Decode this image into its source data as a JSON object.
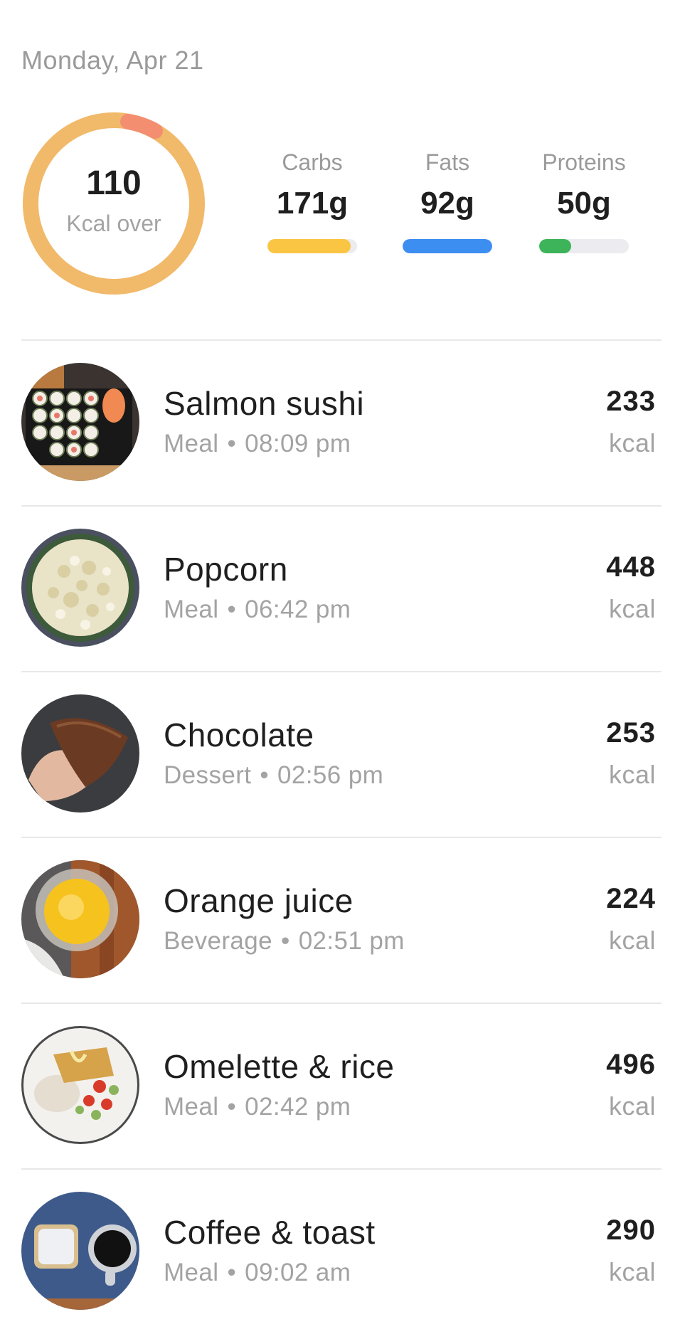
{
  "header": {
    "date": "Monday, Apr 21"
  },
  "summary": {
    "kcal_value": "110",
    "kcal_label": "Kcal over",
    "ring_color": "#f1b96a",
    "ring_accent_color": "#f38a72",
    "macros": [
      {
        "label": "Carbs",
        "value": "171g",
        "color": "#fbc544",
        "fill": 0.93
      },
      {
        "label": "Fats",
        "value": "92g",
        "color": "#3d8ef1",
        "fill": 1.0
      },
      {
        "label": "Proteins",
        "value": "50g",
        "color": "#3db35a",
        "fill": 0.36
      }
    ]
  },
  "entries": [
    {
      "name": "Salmon sushi",
      "category": "Meal",
      "time": "08:09 pm",
      "kcal": "233",
      "unit": "kcal",
      "image": "sushi-photo"
    },
    {
      "name": "Popcorn",
      "category": "Meal",
      "time": "06:42 pm",
      "kcal": "448",
      "unit": "kcal",
      "image": "popcorn-photo"
    },
    {
      "name": "Chocolate",
      "category": "Dessert",
      "time": "02:56 pm",
      "kcal": "253",
      "unit": "kcal",
      "image": "chocolate-photo"
    },
    {
      "name": "Orange juice",
      "category": "Beverage",
      "time": "02:51 pm",
      "kcal": "224",
      "unit": "kcal",
      "image": "orange-juice-photo"
    },
    {
      "name": "Omelette & rice",
      "category": "Meal",
      "time": "02:42 pm",
      "kcal": "496",
      "unit": "kcal",
      "image": "omelette-photo"
    },
    {
      "name": "Coffee & toast",
      "category": "Meal",
      "time": "09:02 am",
      "kcal": "290",
      "unit": "kcal",
      "image": "coffee-toast-photo"
    }
  ]
}
